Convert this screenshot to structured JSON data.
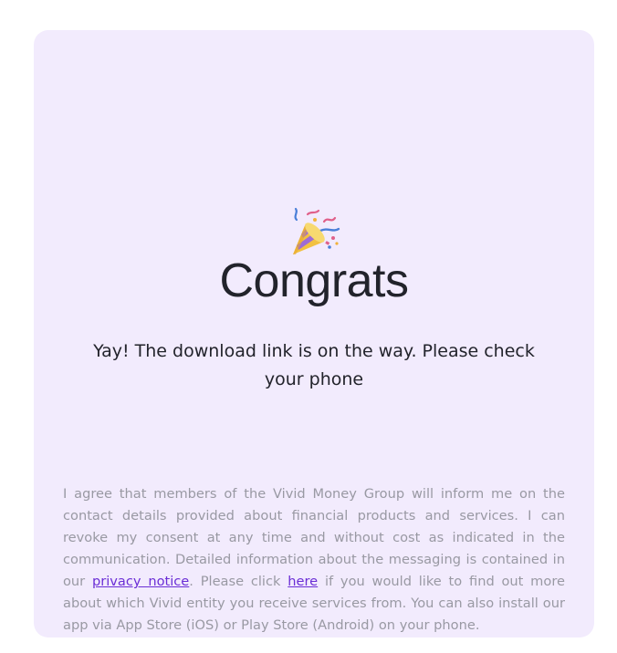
{
  "hero": {
    "icon": "party-popper-icon",
    "title": "Congrats",
    "subtitle": "Yay! The download link is on the way. Please check your phone"
  },
  "legal": {
    "text_1": "I agree that members of the Vivid Money Group will inform me on the contact details provided about financial products and services. I can revoke my consent at any time and without cost as indicated in the communication. Detailed information about the messaging is contained in our ",
    "privacy_link": "privacy notice",
    "text_2": ". Please click ",
    "here_link": "here",
    "text_3": " if you would like to find out more about which Vivid entity you receive services from. You can also install our app via App Store (iOS) or Play Store (Android) on your phone."
  },
  "colors": {
    "card_background": "#f2ebfd",
    "text_primary": "#22232b",
    "text_secondary": "#9999a3",
    "link": "#6b2ed6"
  }
}
